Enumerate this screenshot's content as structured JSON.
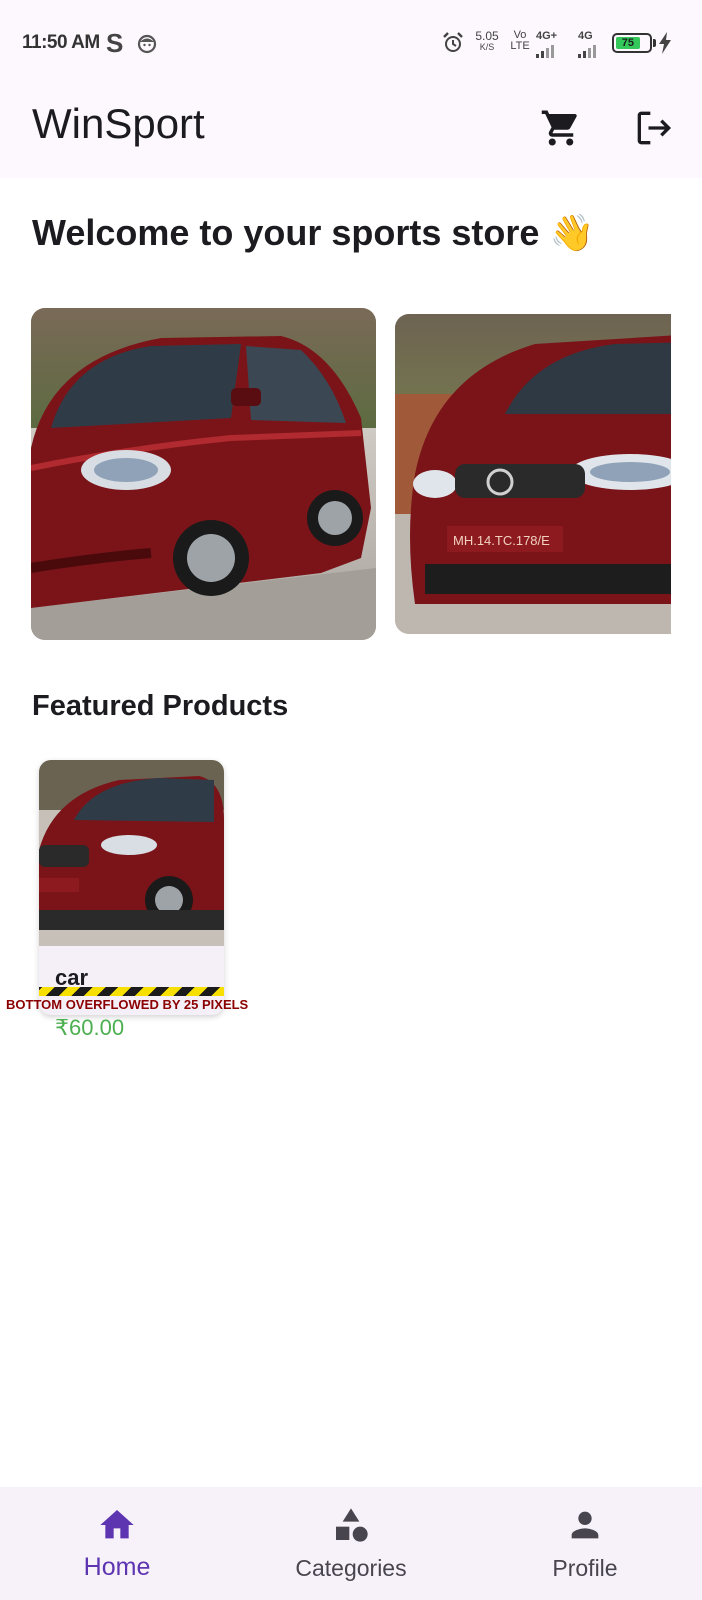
{
  "status_bar": {
    "time": "11:50 AM",
    "speed_value": "5.05",
    "speed_unit": "K/S",
    "volte_top": "Vo",
    "volte_bottom": "LTE",
    "network1": "4G+",
    "network2": "4G",
    "battery": "75",
    "icons": [
      "s-app-icon",
      "face-icon",
      "alarm-icon",
      "signal-icon",
      "battery-icon",
      "charging-icon"
    ]
  },
  "app_bar": {
    "title": "WinSport",
    "icons": [
      "cart-icon",
      "logout-icon"
    ]
  },
  "main": {
    "welcome": "Welcome to your sports store 👋",
    "featured_title": "Featured Products",
    "products": [
      {
        "name": "car",
        "price": "₹60.00"
      }
    ],
    "overflow_warning": "BOTTOM OVERFLOWED BY 25 PIXELS"
  },
  "bottom_nav": {
    "items": [
      {
        "label": "Home",
        "icon": "home-icon",
        "active": true
      },
      {
        "label": "Categories",
        "icon": "shapes-icon",
        "active": false
      },
      {
        "label": "Profile",
        "icon": "person-icon",
        "active": false
      }
    ]
  },
  "colors": {
    "surface": "#fdf7fe",
    "nav_bg": "#f7f2fa",
    "accent": "#5e35b1",
    "price": "#4caf50",
    "overflow_text": "#8b0000"
  }
}
